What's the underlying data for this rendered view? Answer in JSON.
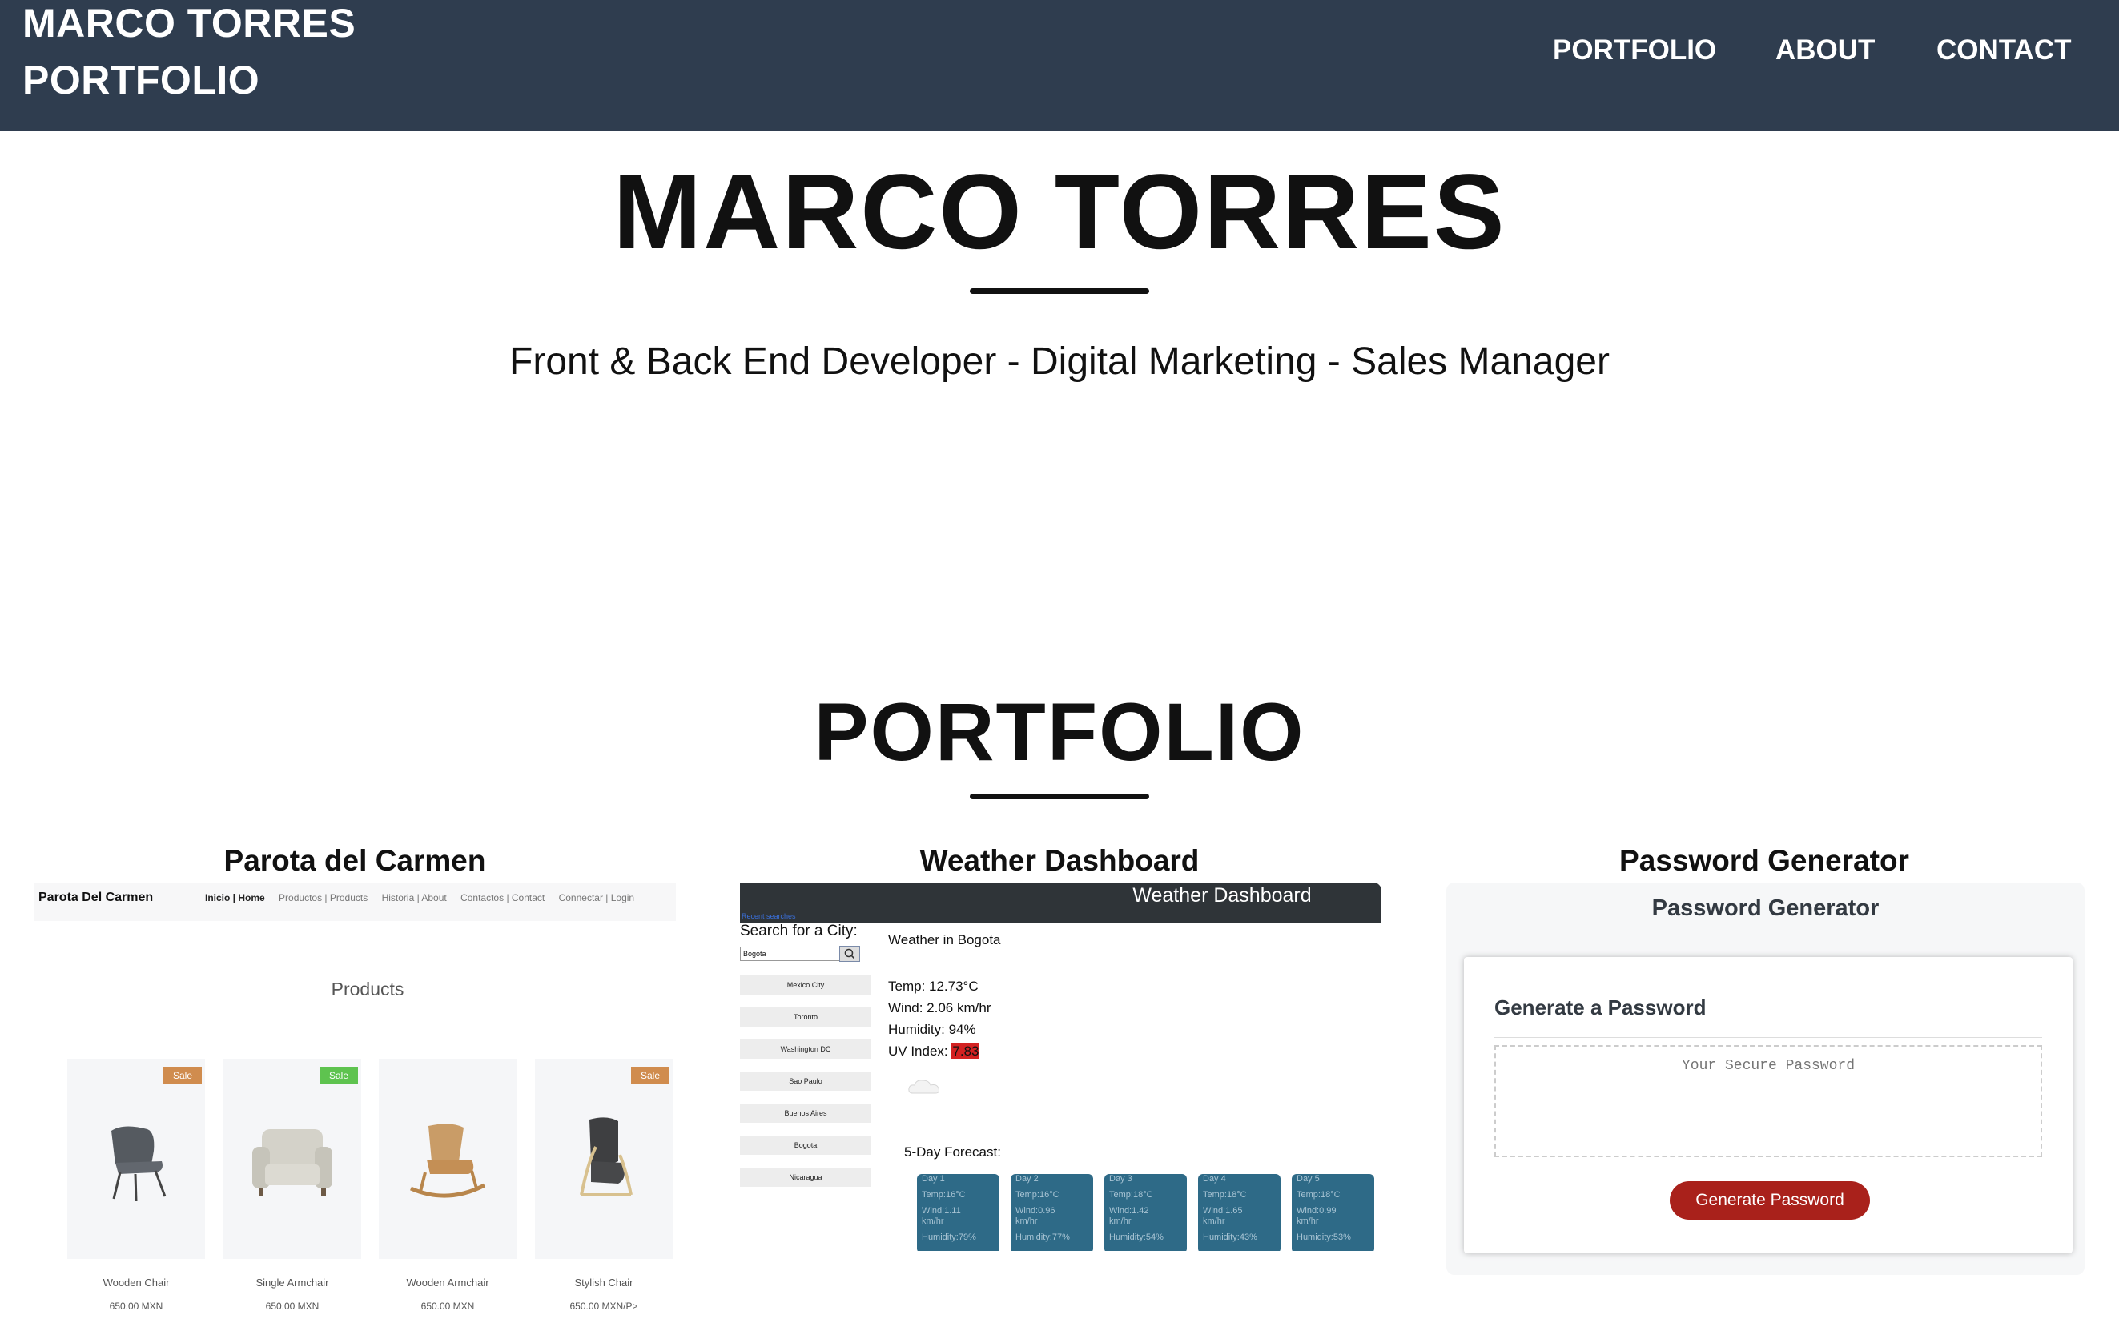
{
  "nav": {
    "brand_line1": "MARCO TORRES",
    "brand_line2": "PORTFOLIO",
    "links": [
      "PORTFOLIO",
      "ABOUT",
      "CONTACT"
    ]
  },
  "hero": {
    "name": "MARCO TORRES",
    "tagline": "Front & Back End Developer - Digital Marketing - Sales Manager"
  },
  "portfolio": {
    "title": "PORTFOLIO",
    "projects": [
      {
        "title": "Parota del Carmen",
        "site_name": "Parota Del Carmen",
        "nav_links": [
          "Inicio | Home",
          "Productos | Products",
          "Historia | About",
          "Contactos | Contact",
          "Connectar | Login"
        ],
        "heading": "Products",
        "products": [
          {
            "name": "Wooden Chair",
            "price": "650.00 MXN",
            "badge": "Sale",
            "badge_color": "#d08c4e"
          },
          {
            "name": "Single Armchair",
            "price": "650.00 MXN",
            "badge": "Sale",
            "badge_color": "#5ec34f"
          },
          {
            "name": "Wooden Armchair",
            "price": "650.00 MXN",
            "badge": "",
            "badge_color": ""
          },
          {
            "name": "Stylish Chair",
            "price": "650.00 MXN/P>",
            "badge": "Sale",
            "badge_color": "#d08c4e"
          }
        ]
      },
      {
        "title": "Weather Dashboard",
        "header": "Weather Dashboard",
        "recent": "Recent searches",
        "search_label": "Search for a City:",
        "search_value": "Bogota",
        "cities": [
          "Mexico City",
          "Toronto",
          "Washington DC",
          "Sao Paulo",
          "Buenos Aires",
          "Bogota",
          "Nicaragua"
        ],
        "weather_title": "Weather in Bogota",
        "temp": "Temp: 12.73°C",
        "wind": "Wind: 2.06 km/hr",
        "humidity": "Humidity: 94%",
        "uv_label": "UV Index:",
        "uv_value": "7.83",
        "forecast_label": "5-Day Forecast:",
        "forecast": [
          {
            "day": "Day 1",
            "temp": "Temp:16°C",
            "wind": "Wind:1.11",
            "unit": "km/hr",
            "humidity": "Humidity:79%"
          },
          {
            "day": "Day 2",
            "temp": "Temp:16°C",
            "wind": "Wind:0.96",
            "unit": "km/hr",
            "humidity": "Humidity:77%"
          },
          {
            "day": "Day 3",
            "temp": "Temp:18°C",
            "wind": "Wind:1.42",
            "unit": "km/hr",
            "humidity": "Humidity:54%"
          },
          {
            "day": "Day 4",
            "temp": "Temp:18°C",
            "wind": "Wind:1.65",
            "unit": "km/hr",
            "humidity": "Humidity:43%"
          },
          {
            "day": "Day 5",
            "temp": "Temp:18°C",
            "wind": "Wind:0.99",
            "unit": "km/hr",
            "humidity": "Humidity:53%"
          }
        ]
      },
      {
        "title": "Password Generator",
        "header": "Password Generator",
        "card_title": "Generate a Password",
        "placeholder": "Your Secure Password",
        "button": "Generate Password"
      }
    ]
  }
}
